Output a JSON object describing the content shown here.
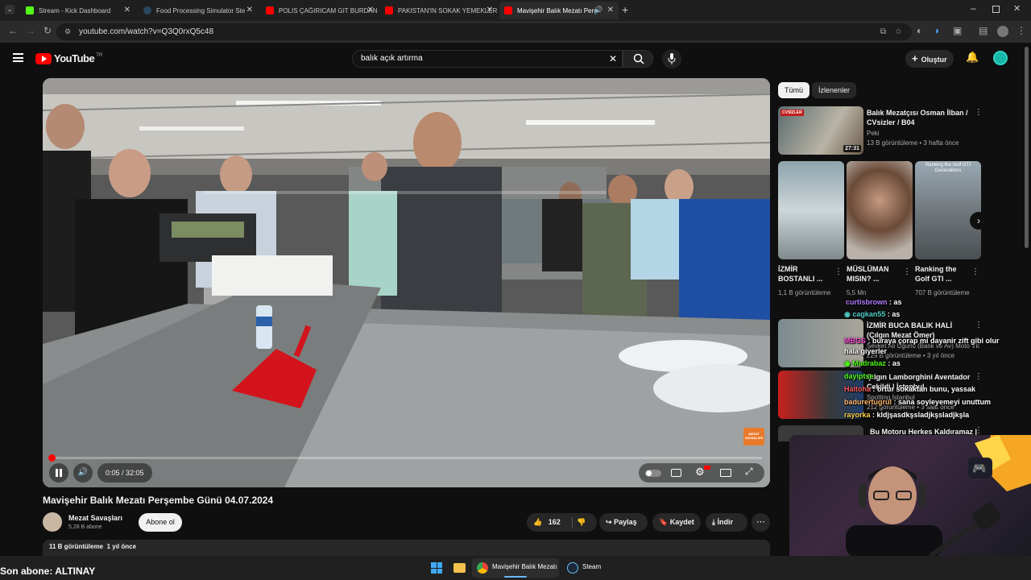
{
  "browser": {
    "tabs": [
      {
        "title": "Stream - Kick Dashboard",
        "color": "#53fc18"
      },
      {
        "title": "Food Processing Simulator Ste",
        "color": "#1b2838"
      },
      {
        "title": "POLIS ÇAĞIRICAM GIT BURDAN",
        "color": "#ff0000"
      },
      {
        "title": "PAKISTAN'IN SOKAK YEMEKLERI",
        "color": "#ff0000"
      },
      {
        "title": "Mavişehir Balık Mezatı Perş",
        "color": "#ff0000"
      }
    ],
    "url": "youtube.com/watch?v=Q3Q0rxQ5c48"
  },
  "youtube": {
    "logo": "YouTube",
    "region": "TR",
    "search_value": "balık açık artırma",
    "create_label": "Oluştur"
  },
  "video": {
    "time": "0:05 / 32:05",
    "progress": 0.003,
    "watermark": "MEZAT SAVAŞLARI",
    "title": "Mavişehir Balık Mezatı Perşembe Günü 04.07.2024",
    "channel": "Mezat Savaşları",
    "subscribers": "5,28 B abone",
    "subscribe_label": "Abone ol",
    "likes": "162",
    "share_label": "Paylaş",
    "save_label": "Kaydet",
    "download_label": "İndir",
    "views_date": "11 B görüntüleme  1 yıl önce"
  },
  "sidebar": {
    "chips": [
      "Tümü",
      "İzlenenler"
    ],
    "rec1": {
      "title": "Balık Mezatçısı Osman İlban / CVsizler / B04",
      "channel": "Peki",
      "meta": "13 B görüntüleme • 3 hafta önce",
      "duration": "27:31",
      "badge": "CVSİZLER"
    },
    "shorts": [
      {
        "title": "İZMİR BOSTANLI ...",
        "meta": "1,1 B görüntüleme"
      },
      {
        "title": "MÜSLÜMAN MISIN? ...",
        "meta": "5,5 Mn"
      },
      {
        "title": "Ranking the Golf GTI ...",
        "meta": "707 B görüntüleme",
        "overlay": "Ranking the Golf GTI Generations"
      }
    ],
    "rec3": {
      "title": "İZMİR BUCA BALIK HALİ (Çılgın Mezat Ömer)",
      "channel": "Şevket Ali Uğurlu (Balık ve Av) Moto Vlog",
      "meta": "229 B görüntüleme • 3 yıl önce"
    },
    "rec4": {
      "title": "Çılgın Lamborghini Aventador Çekildi | İstanbul",
      "channel": "Spotting İstanbul",
      "meta": "212 görüntüleme • 3 saat önce"
    },
    "rec5": {
      "title": "Bu Motoru Herkes Kaldıramaz |"
    }
  },
  "chat": [
    {
      "user": "curtisbrown",
      "text": "as",
      "color": "#b07cff"
    },
    {
      "user": "cagkan55",
      "text": "as",
      "color": "#4ecdc4"
    },
    {
      "user": "MBGS",
      "text": "buraya çorap mi dayanir zift gibi olur hala giyerler",
      "color": "#ff4fd8"
    },
    {
      "user": "Madrabaz",
      "text": "as",
      "color": "#53fc18"
    },
    {
      "user": "dayiptse",
      "text": "",
      "color": "#53fc18"
    },
    {
      "user": "Haltoha",
      "text": "ortur sokaktan bunu, yassak",
      "color": "#ff5b5b"
    },
    {
      "user": "badurertugrul",
      "text": "sana soyleyemeyi unuttum",
      "color": "#ffb86b"
    },
    {
      "user": "rayorka",
      "text": "kldjşasdkşsladjkşsladjkşla",
      "color": "#ffd24a"
    }
  ],
  "overlay": {
    "last_sub": "Son abone: ALTINAY"
  },
  "taskbar": {
    "items": [
      {
        "title": "Mavişehir Balık Mezatı P"
      },
      {
        "title": "Steam"
      }
    ]
  },
  "colors": {
    "accent": "#ff0000",
    "kick": "#53fc18"
  }
}
